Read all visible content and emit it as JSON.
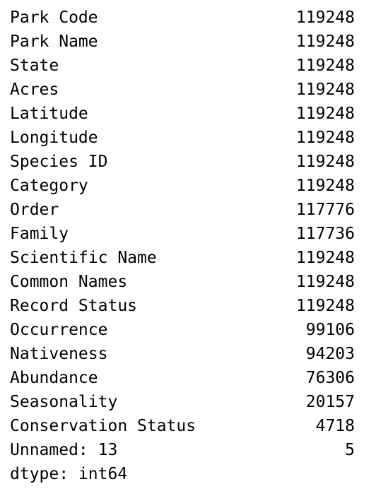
{
  "series_output": {
    "rows": [
      {
        "label": "Park Code",
        "value": "119248"
      },
      {
        "label": "Park Name",
        "value": "119248"
      },
      {
        "label": "State",
        "value": "119248"
      },
      {
        "label": "Acres",
        "value": "119248"
      },
      {
        "label": "Latitude",
        "value": "119248"
      },
      {
        "label": "Longitude",
        "value": "119248"
      },
      {
        "label": "Species ID",
        "value": "119248"
      },
      {
        "label": "Category",
        "value": "119248"
      },
      {
        "label": "Order",
        "value": "117776"
      },
      {
        "label": "Family",
        "value": "117736"
      },
      {
        "label": "Scientific Name",
        "value": "119248"
      },
      {
        "label": "Common Names",
        "value": "119248"
      },
      {
        "label": "Record Status",
        "value": "119248"
      },
      {
        "label": "Occurrence",
        "value": "99106"
      },
      {
        "label": "Nativeness",
        "value": "94203"
      },
      {
        "label": "Abundance",
        "value": "76306"
      },
      {
        "label": "Seasonality",
        "value": "20157"
      },
      {
        "label": "Conservation Status",
        "value": "4718"
      },
      {
        "label": "Unnamed: 13",
        "value": "5"
      }
    ],
    "dtype_line": "dtype: int64"
  }
}
